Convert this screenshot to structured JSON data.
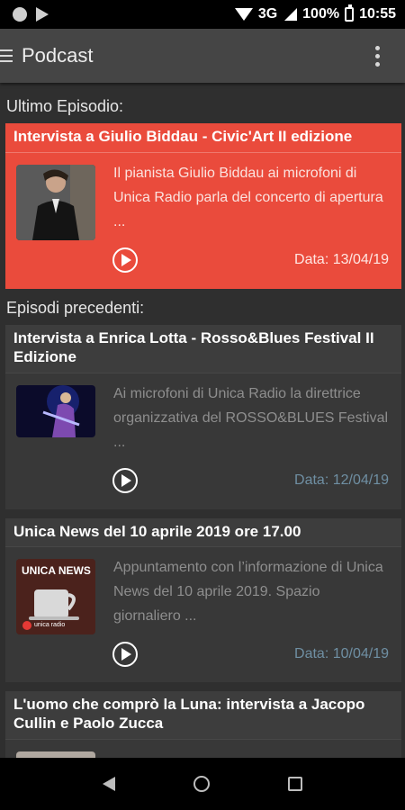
{
  "status_bar": {
    "battery": "100%",
    "time": "10:55",
    "network": "3G"
  },
  "app_bar": {
    "title": "Podcast"
  },
  "sections": {
    "latest": "Ultimo Episodio:",
    "previous": "Episodi precedenti:"
  },
  "featured": {
    "title": "Intervista a Giulio Biddau - Civic'Art II edizione",
    "description": "Il pianista Giulio Biddau ai microfoni di Unica Radio parla del concerto di apertura ...",
    "date": "Data: 13/04/19"
  },
  "episodes": [
    {
      "title": "Intervista a Enrica Lotta - Rosso&Blues Festival II Edizione",
      "description": "Ai microfoni di Unica Radio la direttrice organizzativa del ROSSO&BLUES Festival ...",
      "date": "Data: 12/04/19"
    },
    {
      "title": "Unica News del 10 aprile 2019 ore 17.00",
      "description": "Appuntamento con l’informazione di Unica News del 10 aprile 2019. Spazio giornaliero ...",
      "date": "Data: 10/04/19",
      "thumb_text": "UNICA NEWS",
      "thumb_brand": "unica radio"
    },
    {
      "title": "L'uomo che comprò la Luna: intervista a Jacopo Cullin e Paolo Zucca"
    }
  ],
  "colors": {
    "accent": "#ea4b3c",
    "card": "#3d3d3d",
    "background": "#2f2f2f",
    "appbar": "#454545",
    "date": "#6f8fa3"
  }
}
